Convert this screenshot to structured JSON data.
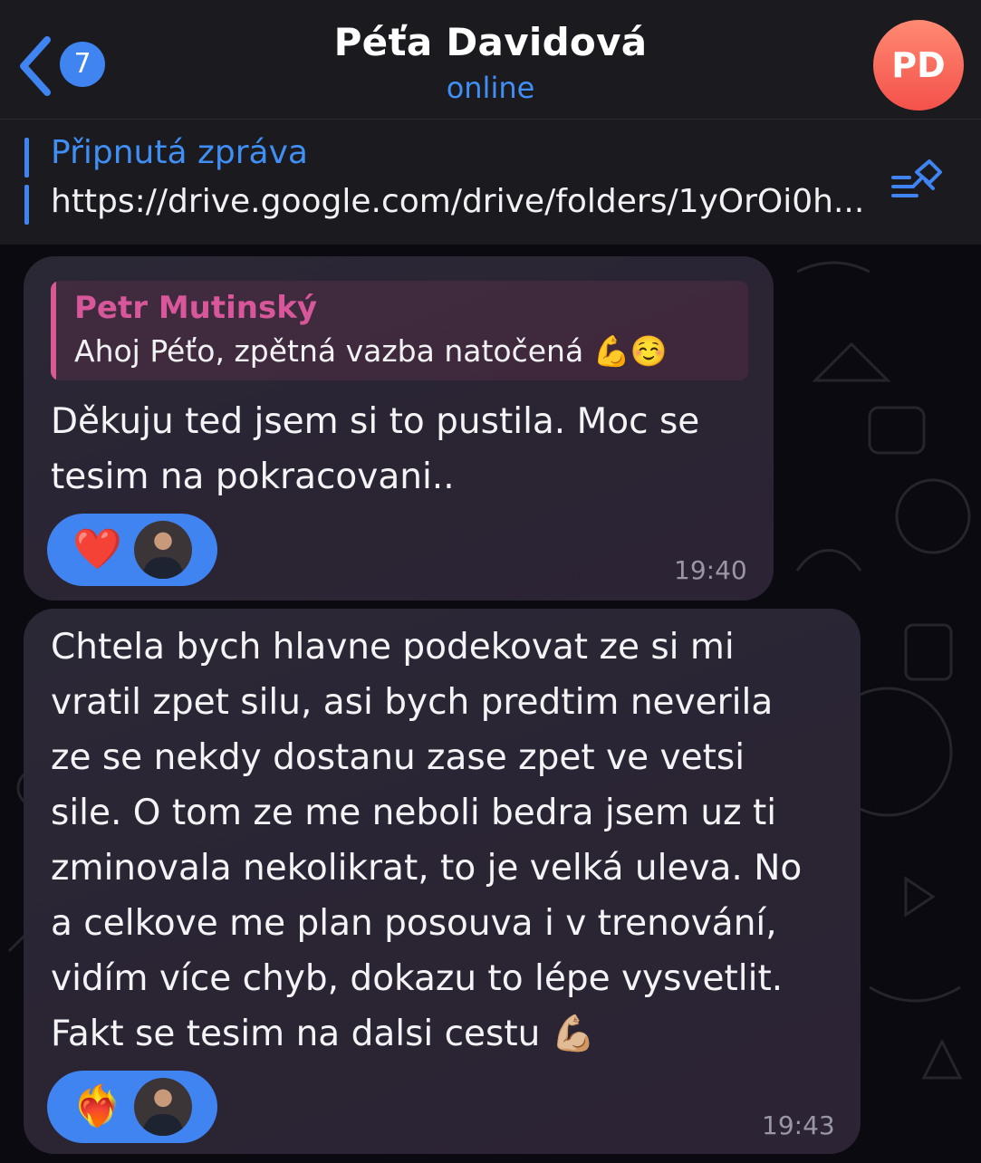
{
  "header": {
    "back_badge": "7",
    "title": "Péťa Davidová",
    "status": "online",
    "avatar_initials": "PD",
    "accent": "#3f84f0"
  },
  "pinned": {
    "title": "Připnutá zpráva",
    "text": "https://drive.google.com/drive/folders/1yOrOi0h..."
  },
  "messages": [
    {
      "reply": {
        "name": "Petr Mutinský",
        "text": "Ahoj Péťo, zpětná vazba natočená 💪☺️"
      },
      "text": "Děkuju ted jsem si to pustila. Moc se\ntesim na pokracovani..",
      "reaction": "❤️",
      "time": "19:40"
    },
    {
      "text": "Chtela bych hlavne podekovat ze si mi\nvratil zpet silu, asi bych predtim neverila\nze se nekdy dostanu zase zpet ve vetsi\nsile. O tom ze me neboli bedra jsem uz ti\nzminovala nekolikrat, to je velká uleva. No\na celkove me plan posouva i v trenování,\nvidím více chyb, dokazu to lépe vysvetlit.\nFakt se tesim na dalsi cestu 💪🏼",
      "reaction": "❤️‍🔥",
      "time": "19:43"
    }
  ],
  "icons": {
    "back": "chevron-left-icon",
    "pin_list": "pin-list-icon",
    "reactor": "reactor-avatar"
  }
}
